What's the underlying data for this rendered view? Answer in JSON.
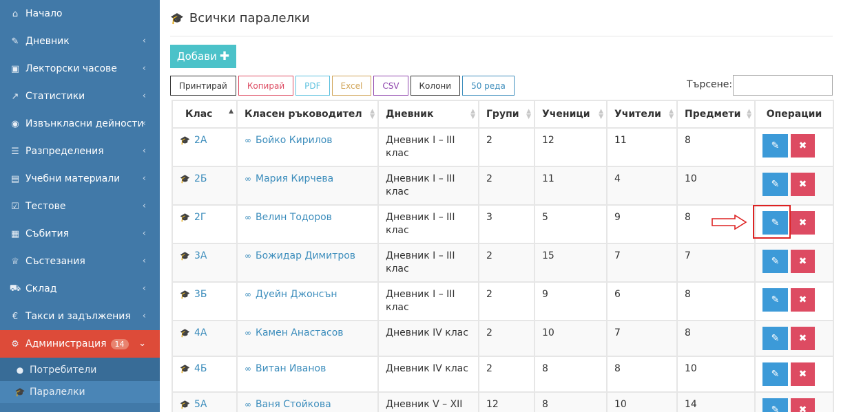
{
  "sidebar": {
    "items": [
      {
        "label": "Начало",
        "icon": "home-icon",
        "glyph": "⌂",
        "chevron": false
      },
      {
        "label": "Дневник",
        "icon": "edit-icon",
        "glyph": "✎",
        "chevron": true
      },
      {
        "label": "Лекторски часове",
        "icon": "calendar-plus-icon",
        "glyph": "▣",
        "chevron": true
      },
      {
        "label": "Статистики",
        "icon": "line-chart-icon",
        "glyph": "↗",
        "chevron": true
      },
      {
        "label": "Извънкласни дейности",
        "icon": "soccer-ball-icon",
        "glyph": "◉",
        "chevron": true
      },
      {
        "label": "Разпределения",
        "icon": "list-alt-icon",
        "glyph": "☰",
        "chevron": true
      },
      {
        "label": "Учебни материали",
        "icon": "book-icon",
        "glyph": "▤",
        "chevron": true
      },
      {
        "label": "Тестове",
        "icon": "check-square-icon",
        "glyph": "☑",
        "chevron": true
      },
      {
        "label": "Събития",
        "icon": "calendar-icon",
        "glyph": "▦",
        "chevron": true
      },
      {
        "label": "Състезания",
        "icon": "trophy-icon",
        "glyph": "♕",
        "chevron": true
      },
      {
        "label": "Склад",
        "icon": "cart-icon",
        "glyph": "⛟",
        "chevron": true
      },
      {
        "label": "Такси и задължения",
        "icon": "euro-icon",
        "glyph": "€",
        "chevron": true
      }
    ],
    "admin": {
      "label": "Администрация",
      "badge": "14",
      "icon": "cogs-icon",
      "glyph": "⚙"
    },
    "sub_items": [
      {
        "label": "Потребители",
        "icon": "user-icon",
        "glyph": "●"
      },
      {
        "label": "Паралелки",
        "icon": "graduation-cap-icon",
        "glyph": "🎓"
      }
    ]
  },
  "page": {
    "title": "Всички паралелки"
  },
  "add_button": {
    "label": "Добави",
    "plus": "✚"
  },
  "toolbar": [
    {
      "label": "Принтирай",
      "color": "#333333"
    },
    {
      "label": "Копирай",
      "color": "#dd4b62"
    },
    {
      "label": "PDF",
      "color": "#5bc0de"
    },
    {
      "label": "Excel",
      "color": "#d0a355"
    },
    {
      "label": "CSV",
      "color": "#8e44ad"
    },
    {
      "label": "Колони",
      "color": "#333333"
    },
    {
      "label": "50 реда",
      "color": "#3c8dbc"
    }
  ],
  "search": {
    "label": "Търсене:",
    "value": ""
  },
  "table": {
    "columns": [
      "Клас",
      "Класен ръководител",
      "Дневник",
      "Групи",
      "Ученици",
      "Учители",
      "Предмети",
      "Операции"
    ],
    "rows": [
      {
        "class": "2А",
        "teacher": "Бойко Кирилов",
        "diary": "Дневник I – III клас",
        "groups": "2",
        "students": "12",
        "teachers": "11",
        "subjects": "8"
      },
      {
        "class": "2Б",
        "teacher": "Мария Кирчева",
        "diary": "Дневник I – III клас",
        "groups": "2",
        "students": "11",
        "teachers": "4",
        "subjects": "10"
      },
      {
        "class": "2Г",
        "teacher": "Велин Тодоров",
        "diary": "Дневник I – III клас",
        "groups": "3",
        "students": "5",
        "teachers": "9",
        "subjects": "8"
      },
      {
        "class": "3А",
        "teacher": "Божидар Димитров",
        "diary": "Дневник I – III клас",
        "groups": "2",
        "students": "15",
        "teachers": "7",
        "subjects": "7"
      },
      {
        "class": "3Б",
        "teacher": "Дуейн Джонсън",
        "diary": "Дневник I – III клас",
        "groups": "2",
        "students": "9",
        "teachers": "6",
        "subjects": "8"
      },
      {
        "class": "4А",
        "teacher": "Камен Анастасов",
        "diary": "Дневник IV клас",
        "groups": "2",
        "students": "10",
        "teachers": "7",
        "subjects": "8"
      },
      {
        "class": "4Б",
        "teacher": "Витан Иванов",
        "diary": "Дневник IV клас",
        "groups": "2",
        "students": "8",
        "teachers": "8",
        "subjects": "10"
      },
      {
        "class": "5А",
        "teacher": "Ваня Стойкова",
        "diary": "Дневник V – XII",
        "groups": "12",
        "students": "8",
        "teachers": "10",
        "subjects": "14"
      }
    ]
  },
  "colors": {
    "sidebar": "#4179a8",
    "active": "#dd4b39",
    "edit": "#3c9ad8",
    "delete": "#dd4b62",
    "accent": "#4bc2c9"
  }
}
